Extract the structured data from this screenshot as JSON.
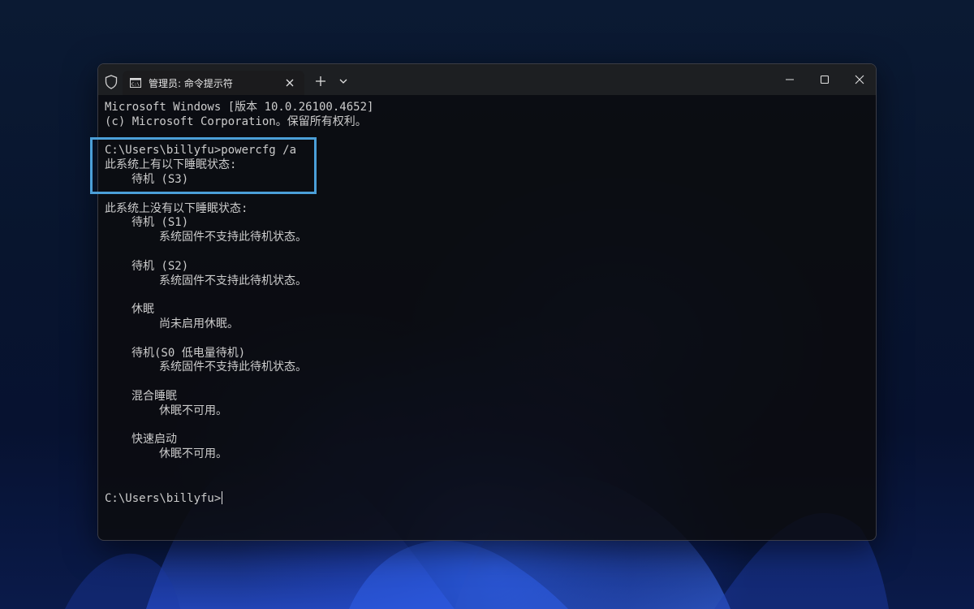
{
  "window": {
    "tab_title": "管理员: 命令提示符",
    "icons": {
      "shield": "shield-icon",
      "tab": "command-prompt-icon",
      "tab_close": "close-icon",
      "new_tab": "plus-icon",
      "dropdown": "chevron-down-icon",
      "minimize": "minimize-icon",
      "maximize": "maximize-icon",
      "close": "close-icon"
    }
  },
  "terminal": {
    "lines": {
      "l1": "Microsoft Windows [版本 10.0.26100.4652]",
      "l2": "(c) Microsoft Corporation。保留所有权利。",
      "l3": "",
      "l4": "C:\\Users\\billyfu>powercfg /a",
      "l5": "此系统上有以下睡眠状态:",
      "l6": "待机 (S3)",
      "l7": "",
      "l8": "此系统上没有以下睡眠状态:",
      "l9": "待机 (S1)",
      "l10": "系统固件不支持此待机状态。",
      "l11": "",
      "l12": "待机 (S2)",
      "l13": "系统固件不支持此待机状态。",
      "l14": "",
      "l15": "休眠",
      "l16": "尚未启用休眠。",
      "l17": "",
      "l18": "待机(S0 低电量待机)",
      "l19": "系统固件不支持此待机状态。",
      "l20": "",
      "l21": "混合睡眠",
      "l22": "休眠不可用。",
      "l23": "",
      "l24": "快速启动",
      "l25": "休眠不可用。",
      "l26": "",
      "l27": "",
      "l28": "C:\\Users\\billyfu>"
    }
  },
  "colors": {
    "highlight_border": "#4b9fd8",
    "terminal_text": "#cccccc",
    "titlebar": "#202124"
  }
}
